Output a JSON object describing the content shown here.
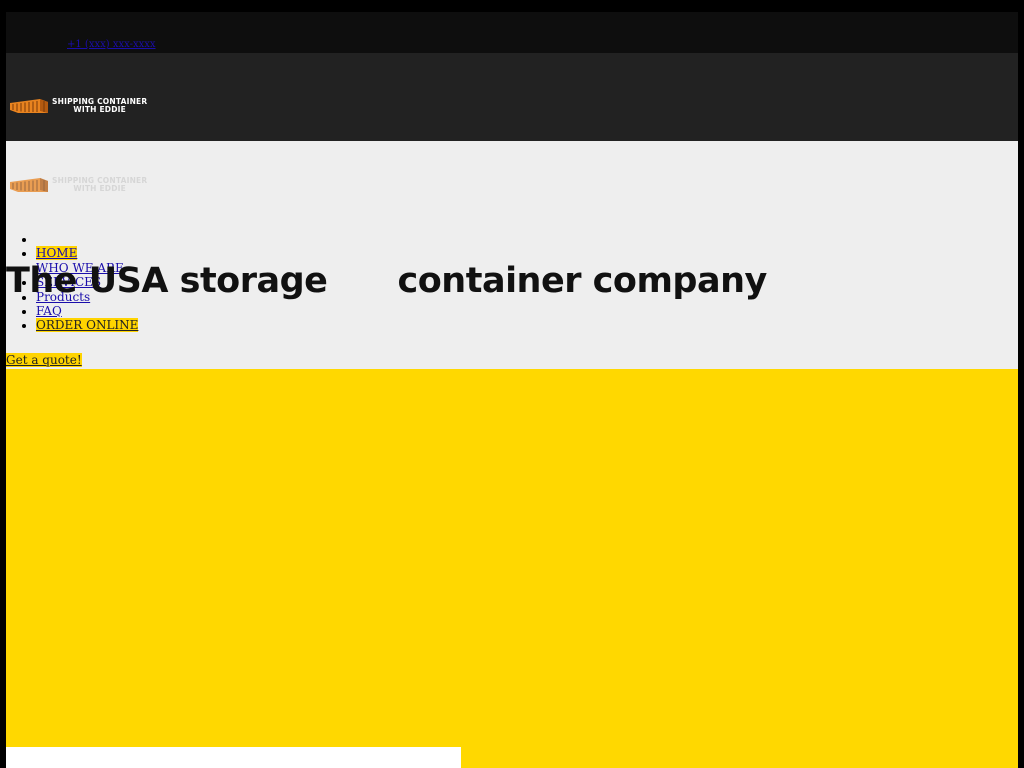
{
  "topbar": {
    "phone_link": "+1 (xxx) xxx-xxxx"
  },
  "brand": {
    "line1": "SHIPPING CONTAINER",
    "line2": "WITH EDDIE"
  },
  "hero": {
    "headline": "The USA storage      container company"
  },
  "nav": {
    "items": [
      {
        "label": ""
      },
      {
        "label": "HOME"
      },
      {
        "label": "WHO WE ARE"
      },
      {
        "label": "SERVICES"
      },
      {
        "label": "Products"
      },
      {
        "label": "FAQ"
      },
      {
        "label": "ORDER ONLINE"
      }
    ]
  },
  "cta": {
    "quote_label": "Get a quote!"
  },
  "colors": {
    "accent_yellow": "#ffd800",
    "header_dark": "#222222",
    "hero_bg": "#eeeeee",
    "logo_orange": "#e8831f"
  }
}
